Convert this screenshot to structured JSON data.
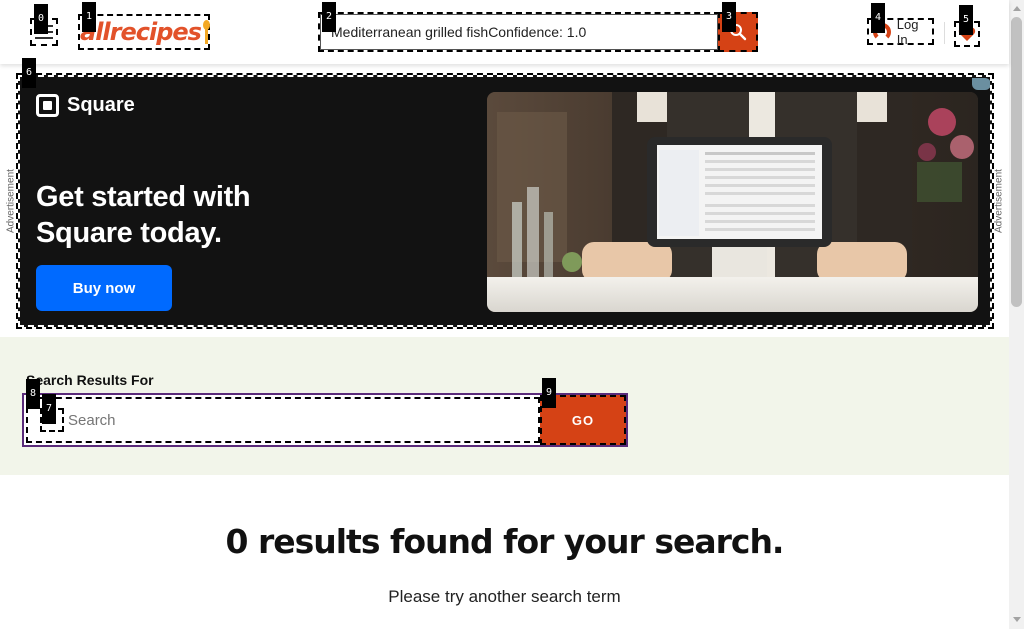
{
  "header": {
    "logo_text": "allrecipes",
    "search_value": "Mediterranean grilled fishConfidence: 1.0",
    "login_label": "Log In"
  },
  "marks": [
    "0",
    "1",
    "2",
    "3",
    "4",
    "5",
    "6",
    "7",
    "8",
    "9"
  ],
  "ad": {
    "side_label": "Advertisement",
    "brand": "Square",
    "headline_line1": "Get started with",
    "headline_line2": "Square today.",
    "cta": "Buy now"
  },
  "search_results": {
    "label": "Search Results For",
    "placeholder": "Search",
    "go_label": "GO"
  },
  "empty_state": {
    "title": "0 results found for your search.",
    "subtitle": "Please try another search term"
  },
  "colors": {
    "brand_orange": "#d54215",
    "ad_background": "#121212",
    "ad_cta": "#006aff",
    "results_band": "#f2f5ea"
  }
}
